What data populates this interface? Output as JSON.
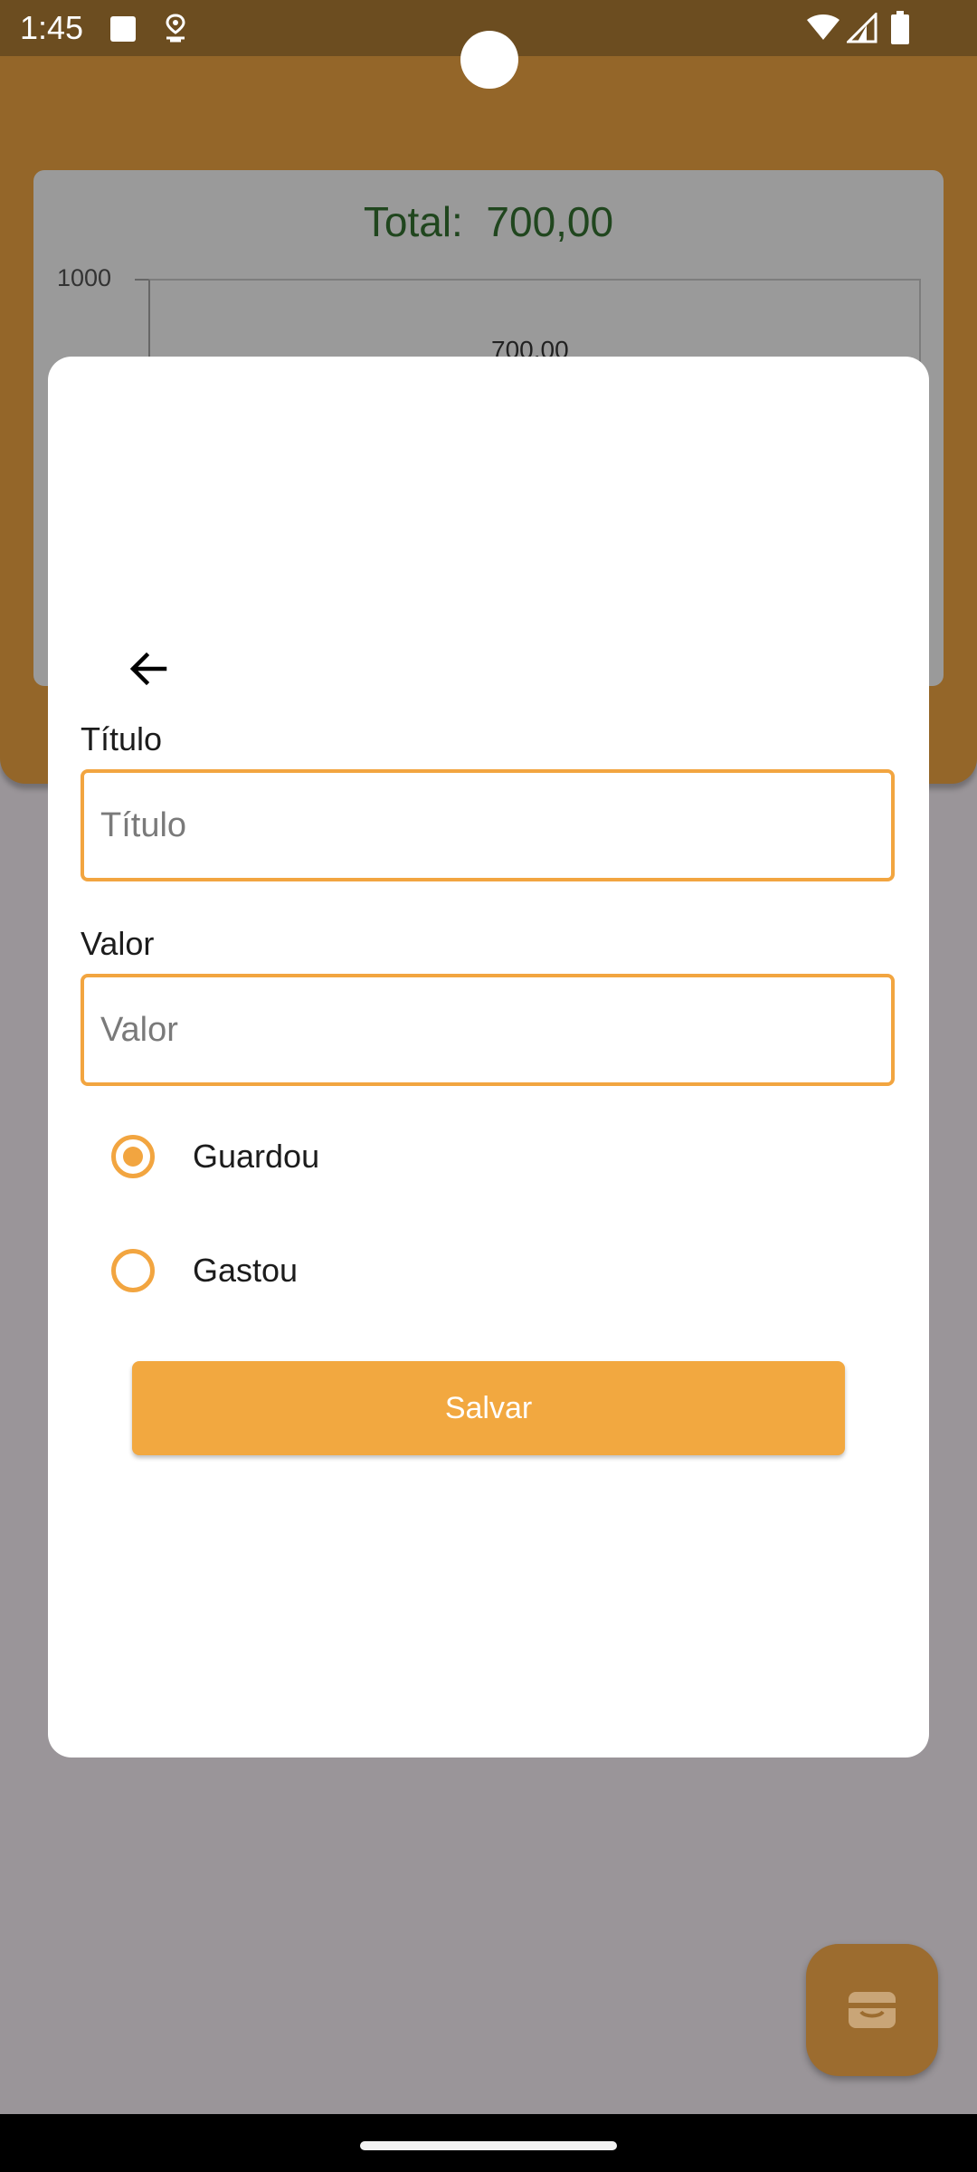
{
  "status_bar": {
    "time": "1:45",
    "icons": [
      "square-notification-icon",
      "location-pin-icon",
      "wifi-icon",
      "cell-signal-icon",
      "battery-icon"
    ]
  },
  "background": {
    "chart_title": "Total:  700,00",
    "chart_data": {
      "type": "bar",
      "title": "Total:  700,00",
      "categories": [
        ""
      ],
      "values": [
        700
      ],
      "data_labels": [
        "700,00"
      ],
      "y_tick_labels": [
        "1000"
      ],
      "ylim": [
        0,
        1000
      ],
      "grid": false
    }
  },
  "modal": {
    "back_icon": "arrow-back-icon",
    "titulo_label": "Título",
    "titulo_placeholder": "Título",
    "titulo_value": "",
    "valor_label": "Valor",
    "valor_placeholder": "Valor",
    "valor_value": "",
    "radio_options": [
      {
        "label": "Guardou",
        "checked": true
      },
      {
        "label": "Gastou",
        "checked": false
      }
    ],
    "save_label": "Salvar"
  },
  "fab": {
    "icon": "wallet-icon"
  },
  "colors": {
    "accent": "#f2a840",
    "header_brown": "#946629",
    "status_brown": "#6c4d20",
    "chart_title_green": "#20461e",
    "scrim": "#9a9599"
  }
}
